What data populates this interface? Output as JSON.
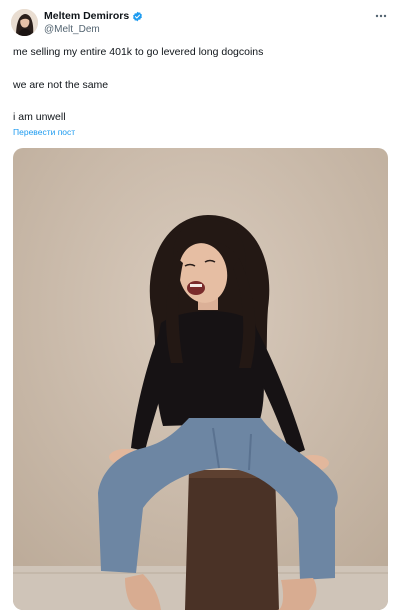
{
  "post": {
    "author_name": "Meltem Demirors",
    "author_handle": "@Melt_Dem",
    "lines": [
      "me selling my entire 401k to go levered long dogcoins",
      "we are not the same",
      "i am unwell"
    ],
    "translate_label": "Перевести пост"
  },
  "colors": {
    "accent": "#1d9bf0",
    "text": "#0f1419",
    "secondary": "#536471"
  },
  "icons": {
    "verified": "verified-badge-icon",
    "more": "more-options-icon"
  }
}
